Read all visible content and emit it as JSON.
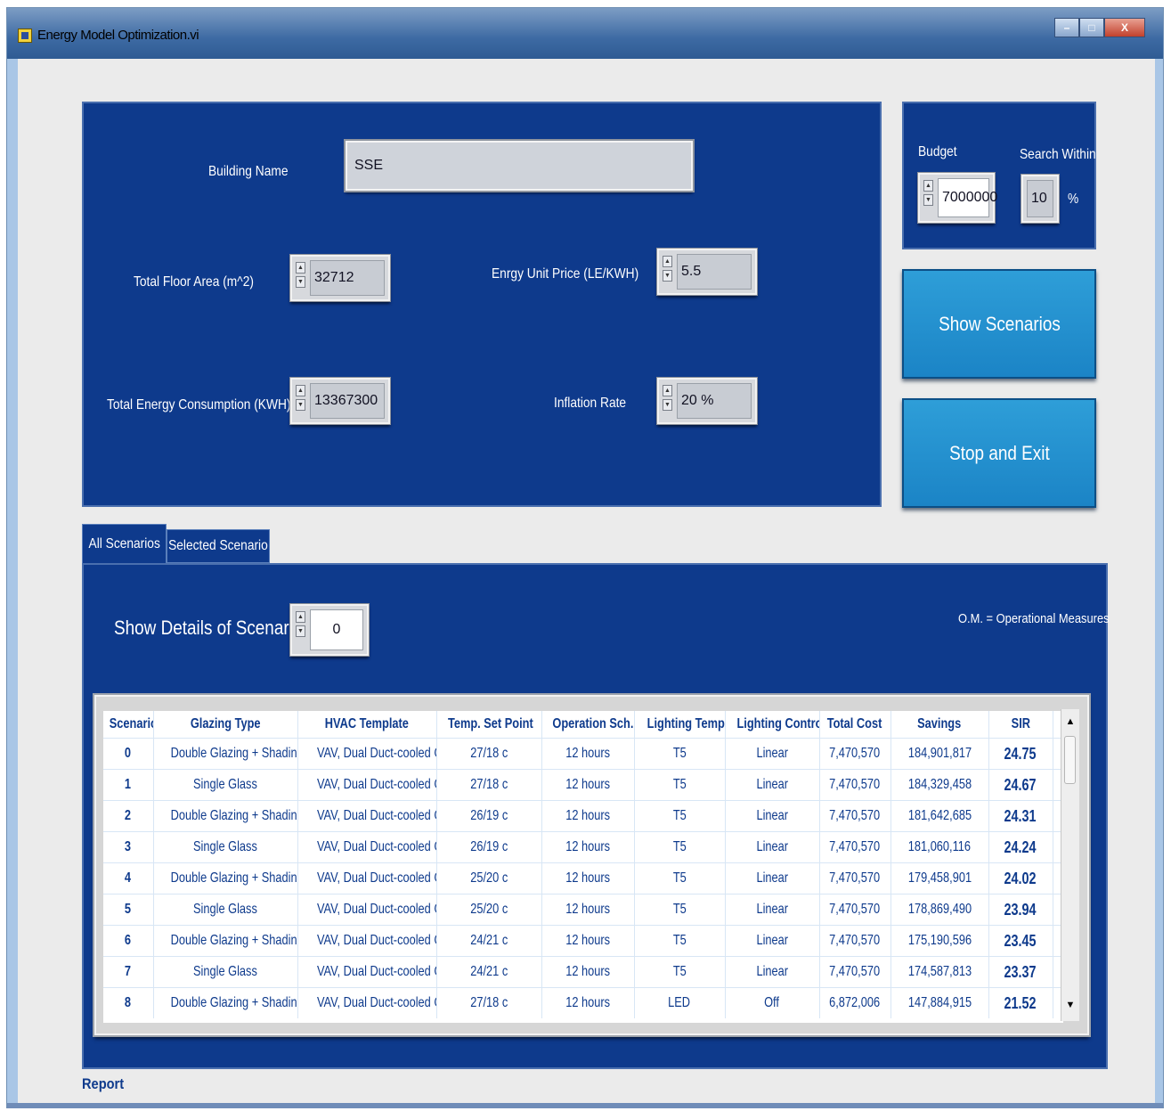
{
  "window": {
    "title": "Energy Model Optimization.vi"
  },
  "inputs": {
    "building_name_label": "Building Name",
    "building_name_value": "SSE",
    "floor_area_label": "Total Floor Area (m^2)",
    "floor_area_value": "32712",
    "energy_consumption_label": "Total Energy Consumption  (KWH)",
    "energy_consumption_value": "13367300",
    "unit_price_label": "Enrgy Unit Price (LE/KWH)",
    "unit_price_value": "5.5",
    "inflation_label": "Inflation Rate",
    "inflation_value": "20 %"
  },
  "budget": {
    "budget_label": "Budget",
    "budget_value": "7000000",
    "search_label": "Search Within",
    "search_value": "10",
    "search_unit": "%"
  },
  "buttons": {
    "show_scenarios": "Show  Scenarios",
    "stop_exit": "Stop and Exit"
  },
  "tabs": [
    {
      "label": "All Scenarios",
      "active": true
    },
    {
      "label": "Selected Scenario",
      "active": false
    }
  ],
  "scenario_panel": {
    "show_details_label": "Show Details of Scenario",
    "show_details_value": "0",
    "legend_note": "O.M. = Operational Measures"
  },
  "table": {
    "columns": [
      "Scenario",
      "Glazing Type",
      "HVAC Template",
      "Temp. Set Point",
      "Operation Sch.",
      "Lighting Template",
      "Lighting Control",
      "Total Cost",
      "Savings",
      "SIR"
    ],
    "rows": [
      [
        "0",
        "Double Glazing + Shading",
        "VAV, Dual Duct-cooled Chiller",
        "27/18 c",
        "12 hours",
        "T5",
        "Linear",
        "7,470,570",
        "184,901,817",
        "24.75"
      ],
      [
        "1",
        "Single Glass",
        "VAV, Dual Duct-cooled Chiller",
        "27/18 c",
        "12 hours",
        "T5",
        "Linear",
        "7,470,570",
        "184,329,458",
        "24.67"
      ],
      [
        "2",
        "Double Glazing + Shading",
        "VAV, Dual Duct-cooled Chiller",
        "26/19 c",
        "12 hours",
        "T5",
        "Linear",
        "7,470,570",
        "181,642,685",
        "24.31"
      ],
      [
        "3",
        "Single Glass",
        "VAV, Dual Duct-cooled Chiller",
        "26/19 c",
        "12 hours",
        "T5",
        "Linear",
        "7,470,570",
        "181,060,116",
        "24.24"
      ],
      [
        "4",
        "Double Glazing + Shading",
        "VAV, Dual Duct-cooled Chiller",
        "25/20 c",
        "12 hours",
        "T5",
        "Linear",
        "7,470,570",
        "179,458,901",
        "24.02"
      ],
      [
        "5",
        "Single Glass",
        "VAV, Dual Duct-cooled Chiller",
        "25/20 c",
        "12 hours",
        "T5",
        "Linear",
        "7,470,570",
        "178,869,490",
        "23.94"
      ],
      [
        "6",
        "Double Glazing + Shading",
        "VAV, Dual Duct-cooled Chiller",
        "24/21 c",
        "12 hours",
        "T5",
        "Linear",
        "7,470,570",
        "175,190,596",
        "23.45"
      ],
      [
        "7",
        "Single Glass",
        "VAV, Dual Duct-cooled Chiller",
        "24/21 c",
        "12 hours",
        "T5",
        "Linear",
        "7,470,570",
        "174,587,813",
        "23.37"
      ],
      [
        "8",
        "Double Glazing + Shading",
        "VAV, Dual Duct-cooled Chiller",
        "27/18 c",
        "12 hours",
        "LED",
        "Off",
        "6,872,006",
        "147,884,915",
        "21.52"
      ]
    ]
  },
  "footer": {
    "report_label": "Report"
  },
  "colors": {
    "panel": "#0e3a8c",
    "button": "#2196d3",
    "table_text": "#0e3a8c",
    "client_bg": "#ebebeb"
  }
}
